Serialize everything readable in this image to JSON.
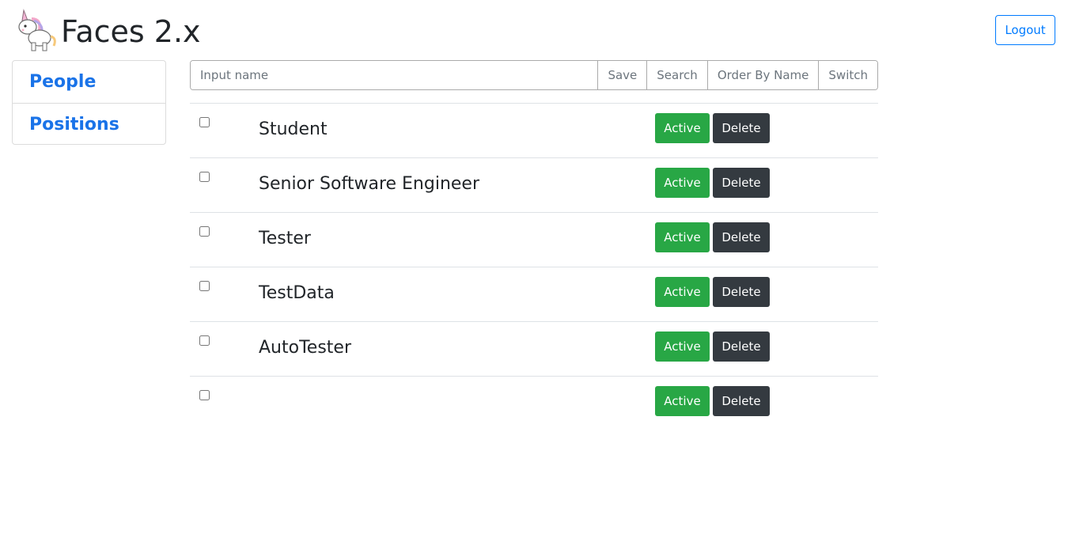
{
  "header": {
    "title": "Faces 2.x",
    "logo_icon": "unicorn-icon",
    "logout_label": "Logout"
  },
  "sidebar": {
    "items": [
      {
        "label": "People"
      },
      {
        "label": "Positions"
      }
    ]
  },
  "toolbar": {
    "input_placeholder": "Input name",
    "input_value": "",
    "save_label": "Save",
    "search_label": "Search",
    "order_label": "Order By Name",
    "switch_label": "Switch"
  },
  "rows": [
    {
      "name": "Student",
      "active_label": "Active",
      "delete_label": "Delete"
    },
    {
      "name": "Senior Software Engineer",
      "active_label": "Active",
      "delete_label": "Delete"
    },
    {
      "name": "Tester",
      "active_label": "Active",
      "delete_label": "Delete"
    },
    {
      "name": "TestData",
      "active_label": "Active",
      "delete_label": "Delete"
    },
    {
      "name": "AutoTester",
      "active_label": "Active",
      "delete_label": "Delete"
    },
    {
      "name": "",
      "active_label": "Active",
      "delete_label": "Delete"
    }
  ],
  "colors": {
    "primary": "#007bff",
    "link": "#1a73e8",
    "success": "#28a745",
    "dark": "#343a40"
  }
}
